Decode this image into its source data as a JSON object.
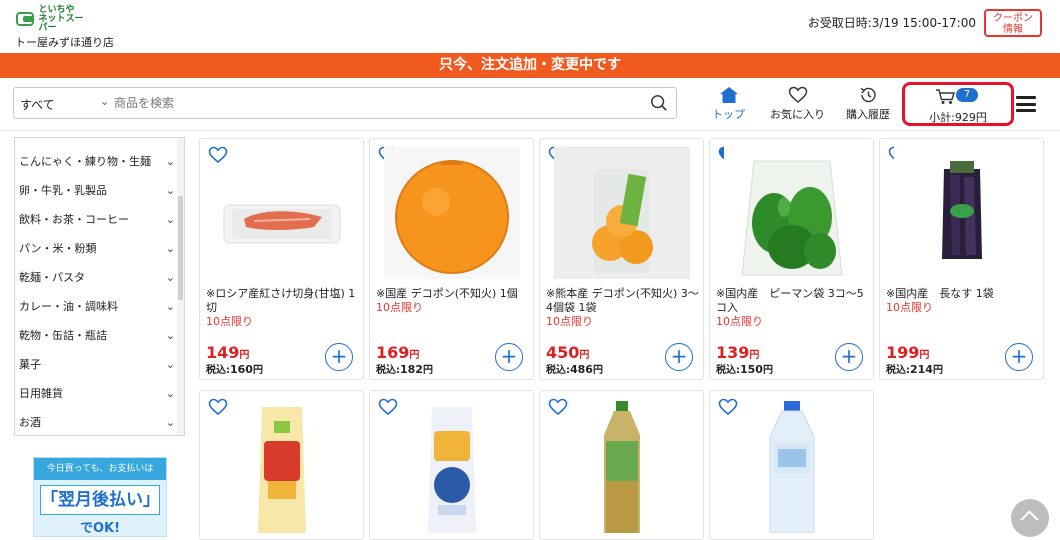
{
  "header": {
    "logo_text": "といちや\nネットスーパー",
    "store_name": "トー屋みずほ通り店",
    "pickup": "お受取日時:3/19 15:00-17:00",
    "coupon_line1": "クーポン",
    "coupon_line2": "情報"
  },
  "banner": {
    "text": "只今、注文追加・変更中です"
  },
  "search": {
    "category": "すべて",
    "placeholder": "商品を検索"
  },
  "nav": {
    "top": "トップ",
    "favorites": "お気に入り",
    "history": "購入履歴",
    "cart_count": "7",
    "cart_subtotal": "小計:929円"
  },
  "colors": {
    "accent": "#1f6fd1",
    "banner": "#f05a1e",
    "price": "#e02020",
    "highlight": "#e8112d"
  },
  "sidebar": {
    "categories": [
      "こんにゃく・練り物・生麺",
      "卵・牛乳・乳製品",
      "飲料・お茶・コーヒー",
      "パン・米・粉類",
      "乾麺・パスタ",
      "カレー・油・調味料",
      "乾物・缶詰・瓶詰",
      "菓子",
      "日用雑貨",
      "お酒"
    ]
  },
  "promo": {
    "top": "今日買っても、お支払いは",
    "main": "「翌月後払い」",
    "sub": "でOK!"
  },
  "products": [
    {
      "name": "※ロシア産紅さけ切身(甘塩) 1切",
      "limit": "10点限り",
      "price": "149",
      "tax": "160",
      "favorite": false
    },
    {
      "name": "※国産 デコポン(不知火) 1個",
      "limit": "10点限り",
      "price": "169",
      "tax": "182",
      "favorite": false
    },
    {
      "name": "※熊本産 デコポン(不知火) 3～4個袋 1袋",
      "limit": "10点限り",
      "price": "450",
      "tax": "486",
      "favorite": false
    },
    {
      "name": "※国内産　ピーマン袋 3コ～5コ入",
      "limit": "10点限り",
      "price": "139",
      "tax": "150",
      "favorite": true
    },
    {
      "name": "※国内産　長なす 1袋",
      "limit": "10点限り",
      "price": "199",
      "tax": "214",
      "favorite": false
    }
  ],
  "labels": {
    "yen": "円",
    "tax_prefix": "税込:"
  }
}
